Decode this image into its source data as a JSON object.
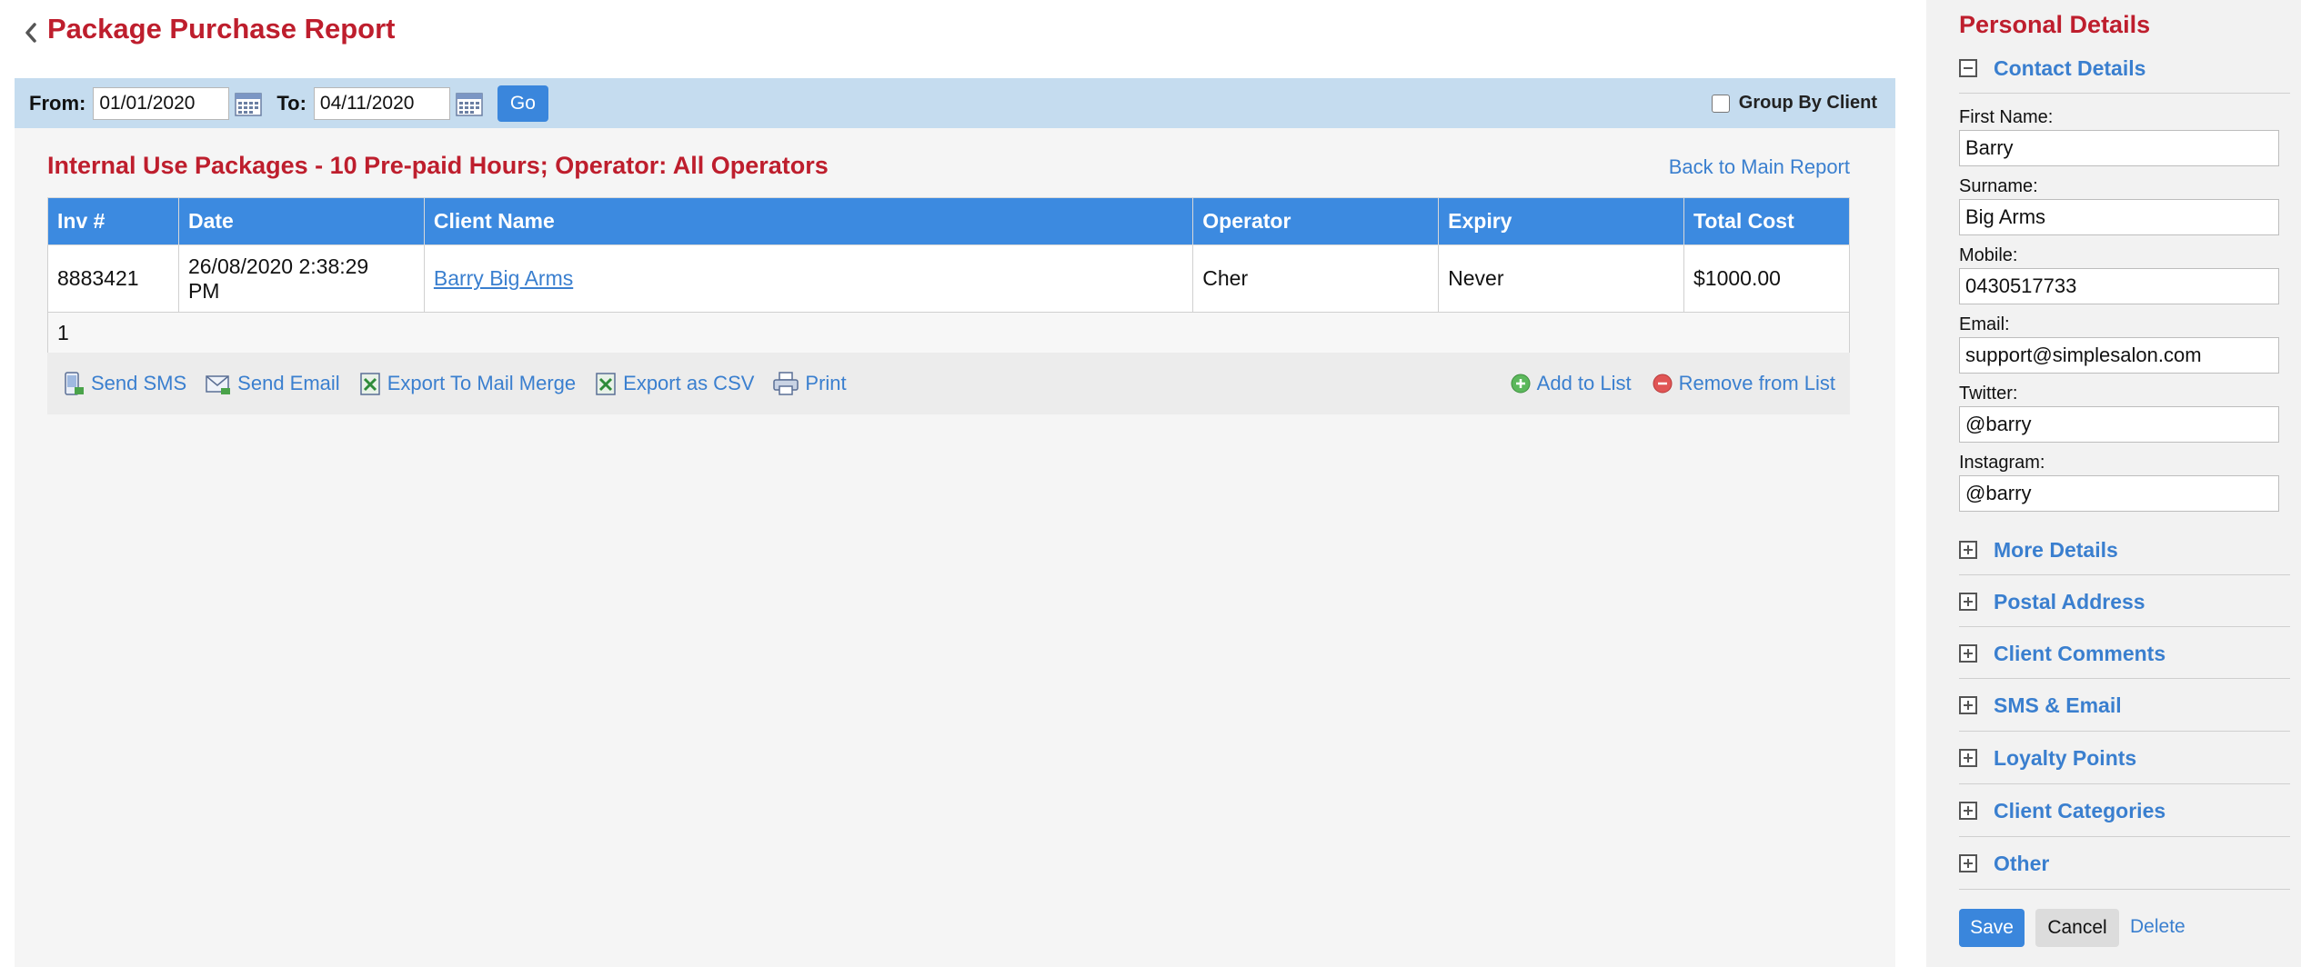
{
  "page": {
    "title": "Package Purchase Report"
  },
  "filter": {
    "from_label": "From:",
    "from_value": "01/01/2020",
    "to_label": "To:",
    "to_value": "04/11/2020",
    "go_label": "Go",
    "group_by_label": "Group By Client",
    "group_by_checked": false
  },
  "report": {
    "title": "Internal Use Packages - 10 Pre-paid Hours; Operator: All Operators",
    "back_link": "Back to Main Report",
    "columns": [
      "Inv #",
      "Date",
      "Client Name",
      "Operator",
      "Expiry",
      "Total Cost"
    ],
    "rows": [
      {
        "inv": "8883421",
        "date_line1": "26/08/2020 2:38:29",
        "date_line2": "PM",
        "client": "Barry Big Arms",
        "operator": "Cher",
        "expiry": "Never",
        "total": "$1000.00"
      }
    ],
    "count": "1"
  },
  "actions": {
    "send_sms": "Send SMS",
    "send_email": "Send Email",
    "export_mail_merge": "Export To Mail Merge",
    "export_csv": "Export as CSV",
    "print": "Print",
    "add_to_list": "Add to List",
    "remove_from_list": "Remove from List"
  },
  "side": {
    "title": "Personal Details",
    "contact_details": "Contact Details",
    "fields": {
      "first_name_label": "First Name:",
      "first_name": "Barry",
      "surname_label": "Surname:",
      "surname": "Big Arms",
      "mobile_label": "Mobile:",
      "mobile": "0430517733",
      "email_label": "Email:",
      "email": "support@simplesalon.com",
      "twitter_label": "Twitter:",
      "twitter": "@barry",
      "instagram_label": "Instagram:",
      "instagram": "@barry"
    },
    "sections": [
      "More Details",
      "Postal Address",
      "Client Comments",
      "SMS & Email",
      "Loyalty Points",
      "Client Categories",
      "Other"
    ],
    "save_label": "Save",
    "cancel_label": "Cancel",
    "delete_label": "Delete"
  },
  "colors": {
    "title_red": "#be1e2d",
    "link_blue": "#3a7fcf",
    "header_blue": "#3c8ae0",
    "filter_bg": "#c5dcef"
  }
}
